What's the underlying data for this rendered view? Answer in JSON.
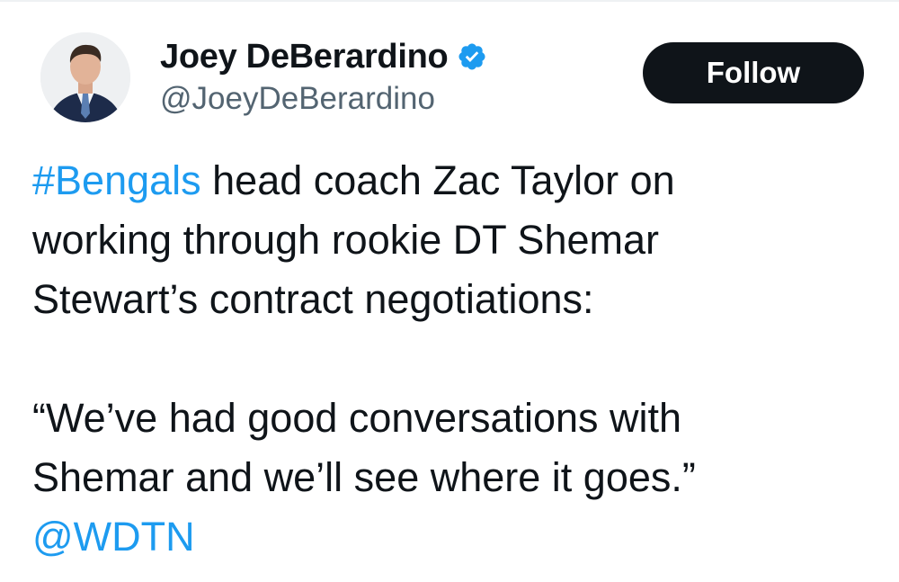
{
  "tweet": {
    "author": {
      "display_name": "Joey DeBerardino",
      "handle": "@JoeyDeBerardino",
      "verified": true,
      "avatar_icon": "profile-photo"
    },
    "follow_label": "Follow",
    "text": {
      "line1_hashtag": "#Bengals",
      "line1_rest": " head coach Zac Taylor on",
      "line2": "working through rookie DT Shemar",
      "line3": "Stewart’s contract negotiations:",
      "quote_line1": "“We’ve had good conversations with",
      "quote_line2": "Shemar and we’ll see where it goes.”",
      "mention": "@WDTN"
    }
  },
  "colors": {
    "link": "#1d9bf0",
    "text": "#0f1419",
    "secondary": "#536471",
    "follow_bg": "#0f1419",
    "follow_text": "#ffffff",
    "verified_badge": "#1d9bf0"
  },
  "icons": {
    "verified": "verified-badge-icon"
  }
}
